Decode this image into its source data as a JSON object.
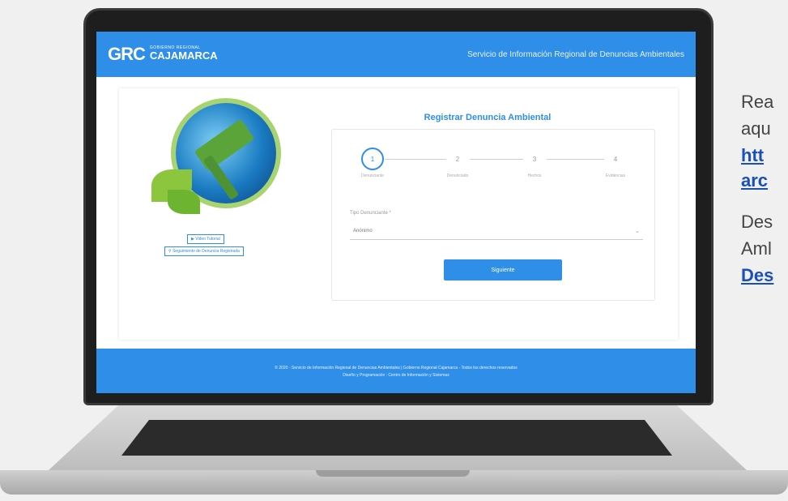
{
  "colors": {
    "primary": "#2e8ee8",
    "background": "#f0f0f0",
    "link": "#1b4fb8"
  },
  "app": {
    "brand": {
      "logo_text": "GRC",
      "small": "GOBIERNO REGIONAL",
      "name": "CAJAMARCA",
      "tagline": ""
    },
    "header_title": "Servicio de Información Regional de Denuncias Ambientales"
  },
  "left_panel": {
    "video_button": "Video Tutorial",
    "track_button": "Seguimiento de Denuncia Registrada"
  },
  "form": {
    "title": "Registrar Denuncia Ambiental",
    "steps": [
      {
        "number": "1",
        "label": "Denunciante"
      },
      {
        "number": "2",
        "label": "Denunciado"
      },
      {
        "number": "3",
        "label": "Hechos"
      },
      {
        "number": "4",
        "label": "Evidencias"
      }
    ],
    "active_step": 1,
    "field_label": "Tipo Denunciante *",
    "field_value": "Anónimo",
    "next_button": "Siguiente"
  },
  "footer": {
    "line1": "© 2020 - Servicio de Información Regional de Denuncias Ambientales | Gobierno Regional Cajamarca - Todos los derechos reservados",
    "line2": "Diseño y Programación : Centro de Información y Sistemas"
  },
  "side": {
    "text1": "Rea",
    "text2": "aqu",
    "link1": "htt",
    "link2": "arc",
    "text3": "Des",
    "text4": "Aml",
    "link3": "Des"
  }
}
